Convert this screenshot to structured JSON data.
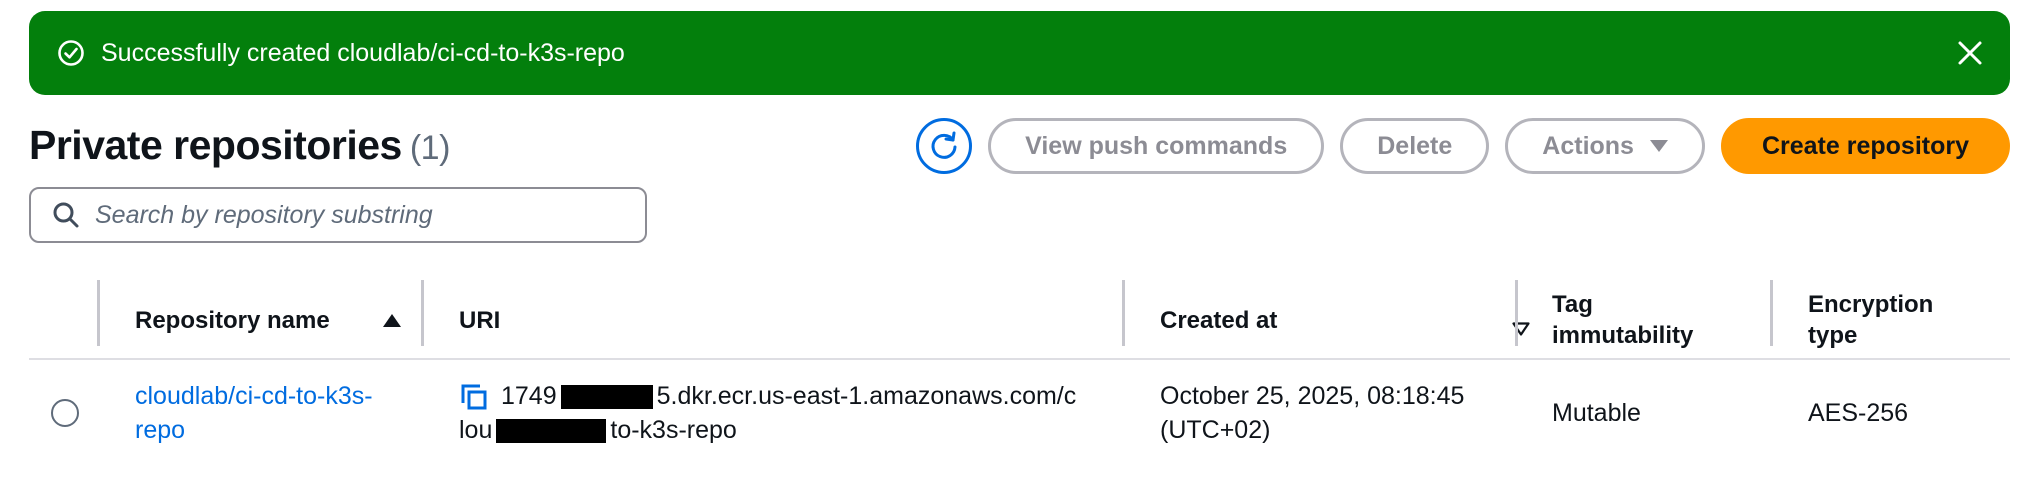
{
  "flash": {
    "message": "Successfully created cloudlab/ci-cd-to-k3s-repo",
    "status_color": "#037f0c"
  },
  "header": {
    "title": "Private repositories",
    "count": "(1)"
  },
  "toolbar": {
    "view_push_label": "View push commands",
    "delete_label": "Delete",
    "actions_label": "Actions",
    "create_label": "Create repository",
    "accent_color": "#ff9900"
  },
  "search": {
    "placeholder": "Search by repository substring",
    "value": ""
  },
  "table": {
    "columns": [
      "Repository name",
      "URI",
      "Created at",
      "Tag immutability",
      "Encryption type"
    ],
    "rows": [
      {
        "name_line1": "cloudlab/ci-cd-to-k3s-",
        "name_line2": "repo",
        "uri_line1_prefix": "1749",
        "uri_line1_suffix": "5.dkr.ecr.us-east-1.amazonaws.com/c",
        "uri_line2_prefix": "lou",
        "uri_line2_suffix": "to-k3s-repo",
        "created_line1": "October 25, 2025, 08:18:45",
        "created_line2": "(UTC+02)",
        "tag_immutability": "Mutable",
        "encryption": "AES-256"
      }
    ]
  },
  "icons": {
    "flash_status": "check-circle-icon",
    "flash_close": "close-icon",
    "refresh": "refresh-icon",
    "search": "search-icon",
    "copy": "copy-icon"
  },
  "link_color": "#006ce0"
}
